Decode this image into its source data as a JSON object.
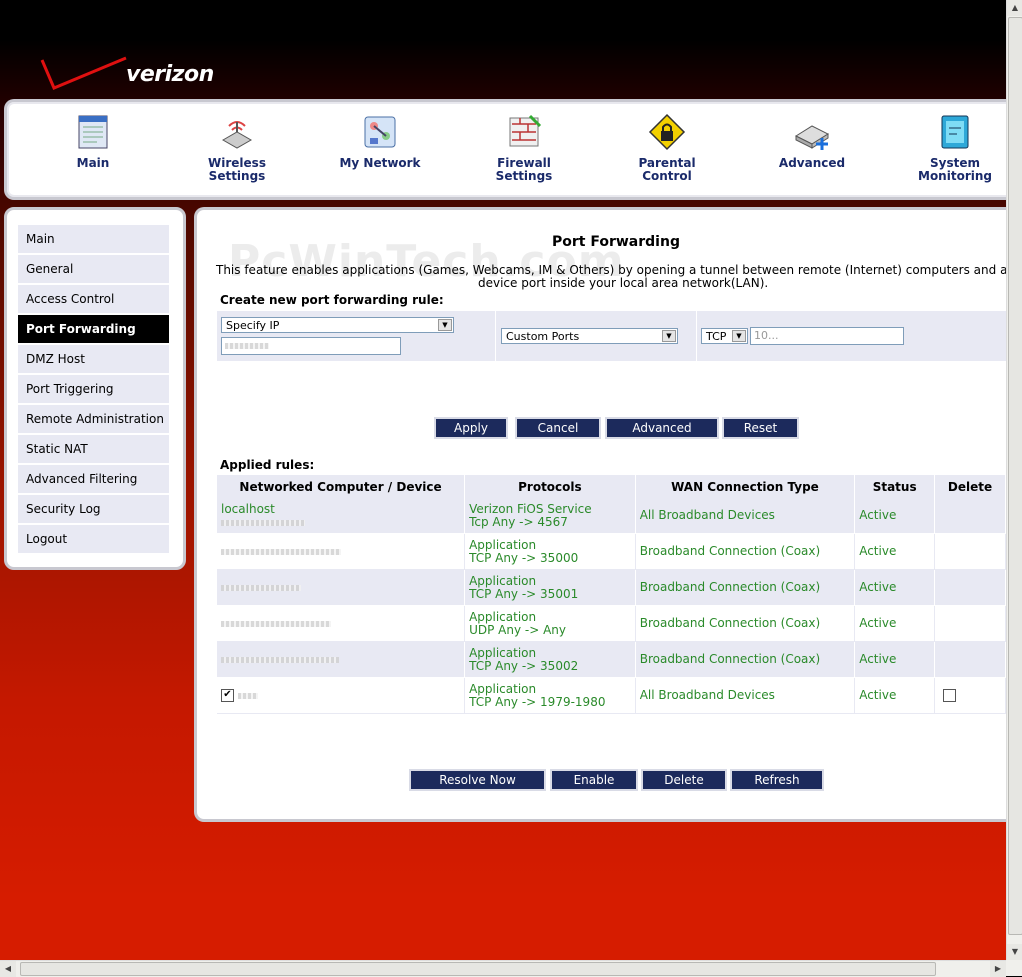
{
  "brand": {
    "logo_text": "verizon"
  },
  "watermark": "PcWinTech.com",
  "topnav": [
    {
      "label": "Main",
      "icon": "main-icon"
    },
    {
      "label": "Wireless\nSettings",
      "icon": "wireless-icon"
    },
    {
      "label": "My Network",
      "icon": "network-icon"
    },
    {
      "label": "Firewall\nSettings",
      "icon": "firewall-icon"
    },
    {
      "label": "Parental\nControl",
      "icon": "parental-lock-icon"
    },
    {
      "label": "Advanced",
      "icon": "advanced-icon"
    },
    {
      "label": "System\nMonitoring",
      "icon": "monitor-icon"
    }
  ],
  "sidebar": {
    "items": [
      {
        "label": "Main"
      },
      {
        "label": "General"
      },
      {
        "label": "Access Control"
      },
      {
        "label": "Port Forwarding",
        "active": true
      },
      {
        "label": "DMZ Host"
      },
      {
        "label": "Port Triggering"
      },
      {
        "label": "Remote Administration"
      },
      {
        "label": "Static NAT"
      },
      {
        "label": "Advanced Filtering"
      },
      {
        "label": "Security Log"
      },
      {
        "label": "Logout"
      }
    ]
  },
  "main": {
    "title": "Port Forwarding",
    "description_line1": "This feature enables applications (Games, Webcams, IM & Others) by opening a tunnel between remote (Internet) computers and a specific",
    "description_line2": "device port inside your local area network(LAN).",
    "create_label": "Create new port forwarding rule:",
    "create": {
      "ip_select": "Specify IP",
      "ports_select": "Custom Ports",
      "protocol_select": "TCP",
      "port_value": "10..."
    },
    "buttons1": {
      "apply": "Apply",
      "cancel": "Cancel",
      "advanced": "Advanced",
      "reset": "Reset"
    },
    "applied_label": "Applied rules:",
    "table": {
      "headers": [
        "Networked Computer / Device",
        "Protocols",
        "WAN Connection Type",
        "Status",
        "Delete"
      ],
      "rows": [
        {
          "device": "localhost",
          "proto1": "Verizon FiOS Service",
          "proto2": "Tcp Any -> 4567",
          "wan": "All Broadband Devices",
          "status": "Active"
        },
        {
          "device": "",
          "proto1": "Application",
          "proto2": "TCP Any -> 35000",
          "wan": "Broadband Connection (Coax)",
          "status": "Active"
        },
        {
          "device": "",
          "proto1": "Application",
          "proto2": "TCP Any -> 35001",
          "wan": "Broadband Connection (Coax)",
          "status": "Active"
        },
        {
          "device": "",
          "proto1": "Application",
          "proto2": "UDP Any -> Any",
          "wan": "Broadband Connection (Coax)",
          "status": "Active"
        },
        {
          "device": "",
          "proto1": "Application",
          "proto2": "TCP Any -> 35002",
          "wan": "Broadband Connection (Coax)",
          "status": "Active"
        },
        {
          "device": "",
          "proto1": "Application",
          "proto2": "TCP Any -> 1979-1980",
          "wan": "All Broadband Devices",
          "status": "Active"
        }
      ]
    },
    "buttons2": {
      "resolve": "Resolve Now",
      "enable": "Enable",
      "delete": "Delete",
      "refresh": "Refresh"
    }
  }
}
